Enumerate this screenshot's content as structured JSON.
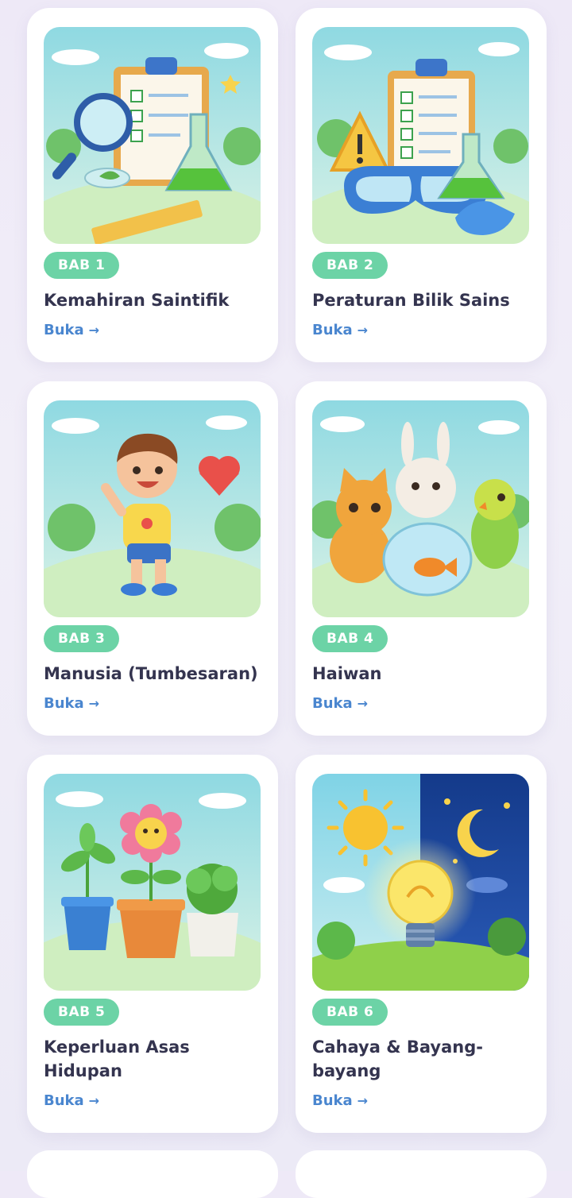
{
  "chapters": [
    {
      "badge": "BAB 1",
      "title": "Kemahiran Saintifik",
      "open_label": "Buka",
      "arrow": "→",
      "image": "scientific-skills-illustration"
    },
    {
      "badge": "BAB 2",
      "title": "Peraturan Bilik Sains",
      "open_label": "Buka",
      "arrow": "→",
      "image": "science-room-rules-illustration"
    },
    {
      "badge": "BAB 3",
      "title": "Manusia (Tumbesaran)",
      "open_label": "Buka",
      "arrow": "→",
      "image": "human-growth-illustration"
    },
    {
      "badge": "BAB 4",
      "title": "Haiwan",
      "open_label": "Buka",
      "arrow": "→",
      "image": "animals-illustration"
    },
    {
      "badge": "BAB 5",
      "title": "Keperluan Asas Hidupan",
      "open_label": "Buka",
      "arrow": "→",
      "image": "plants-needs-illustration"
    },
    {
      "badge": "BAB 6",
      "title": "Cahaya & Bayang-bayang",
      "open_label": "Buka",
      "arrow": "→",
      "image": "light-shadow-illustration"
    }
  ],
  "colors": {
    "badge": "#6cd3a6",
    "link": "#4a86cf",
    "title": "#34344f"
  }
}
